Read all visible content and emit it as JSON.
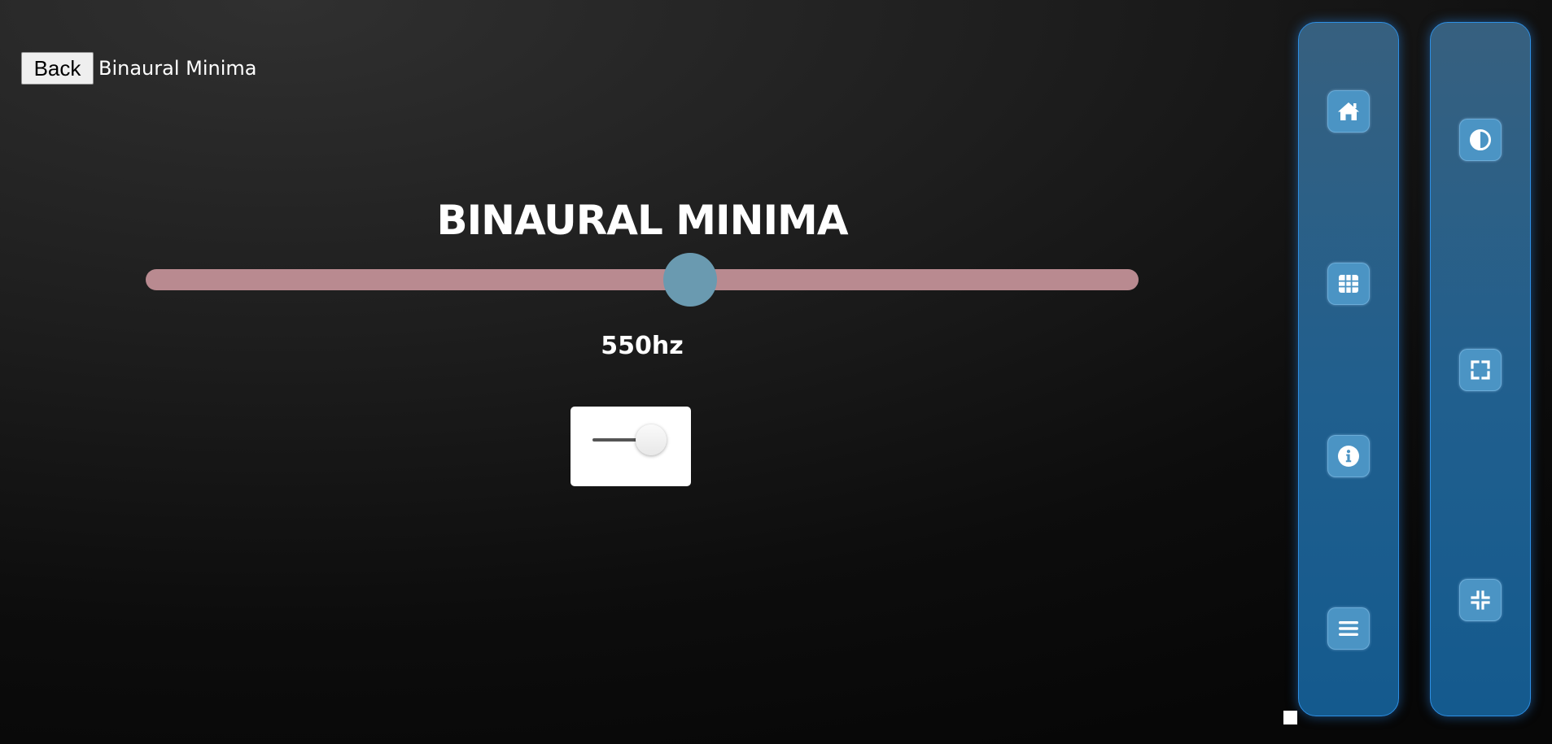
{
  "header": {
    "back_label": "Back",
    "title": "Binaural Minima"
  },
  "main": {
    "title": "BINAURAL MINIMA",
    "frequency_readout": "550hz",
    "slider": {
      "position_fraction": 0.548,
      "track_color": "#b98a90",
      "thumb_color": "#6a9ab0"
    },
    "toggle": {
      "state": "on"
    }
  },
  "sidebar_left": {
    "buttons": [
      {
        "icon": "home-icon"
      },
      {
        "icon": "grid-icon"
      },
      {
        "icon": "info-icon"
      },
      {
        "icon": "menu-icon"
      }
    ]
  },
  "sidebar_right": {
    "buttons": [
      {
        "icon": "contrast-icon"
      },
      {
        "icon": "fullscreen-icon"
      },
      {
        "icon": "exit-fullscreen-icon"
      }
    ]
  },
  "colors": {
    "panel_border": "#2d8fe4",
    "button_fill": "#4b94c4"
  },
  "stop_control": {
    "icon": "stop-square-icon"
  }
}
